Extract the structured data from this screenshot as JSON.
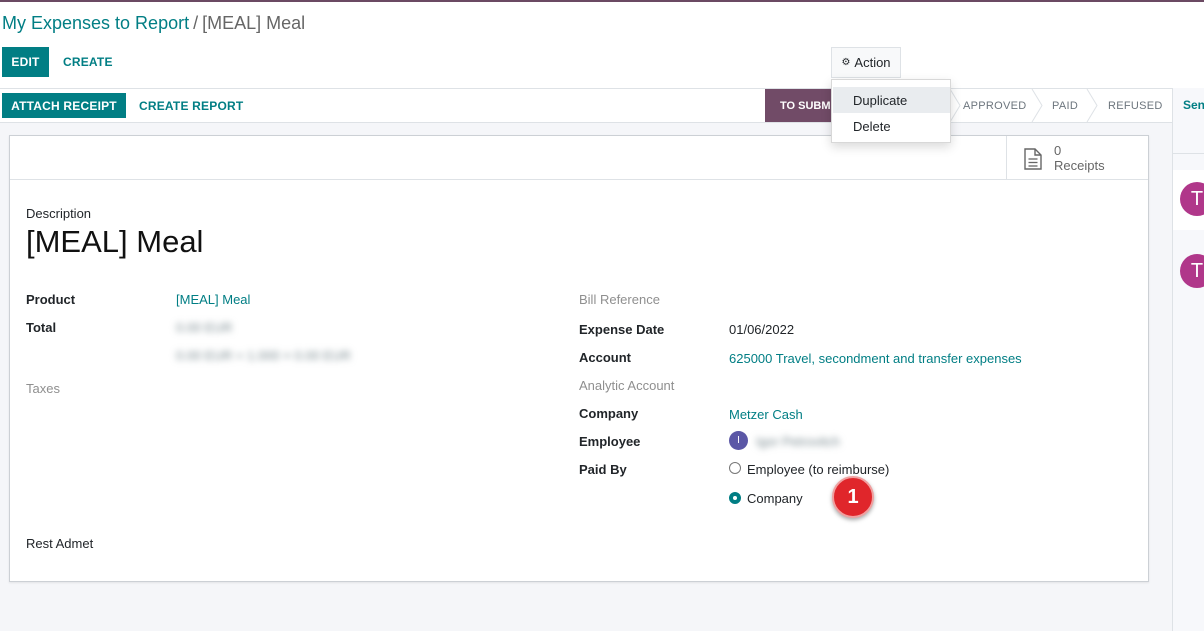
{
  "breadcrumb": {
    "parent": "My Expenses to Report",
    "separator": "/",
    "current": "[MEAL] Meal"
  },
  "control": {
    "edit_label": "EDIT",
    "create_label": "CREATE",
    "action_label": "Action"
  },
  "action_menu": {
    "items": [
      "Duplicate",
      "Delete"
    ]
  },
  "header": {
    "attach_label": "ATTACH RECEIPT",
    "create_report_label": "CREATE REPORT",
    "active_stage": "TO SUBMIT",
    "stages": [
      "APPROVED",
      "PAID",
      "REFUSED"
    ]
  },
  "chatter": {
    "send_label": "Send",
    "avatar_letter": "T"
  },
  "receipts": {
    "count": "0",
    "label": "Receipts"
  },
  "form": {
    "description_label": "Description",
    "title": "[MEAL] Meal",
    "product_label": "Product",
    "product_value": "[MEAL] Meal",
    "total_label": "Total",
    "total_value": "0.00 EUR",
    "total_detail": "0.00 EUR = 1.000 × 0.00 EUR",
    "taxes_label": "Taxes",
    "notes": "Rest Admet",
    "bill_ref_label": "Bill Reference",
    "expense_date_label": "Expense Date",
    "expense_date_value": "01/06/2022",
    "account_label": "Account",
    "account_value": "625000 Travel, secondment and transfer expenses",
    "analytic_label": "Analytic Account",
    "company_label": "Company",
    "company_value": "Metzer Cash",
    "employee_label": "Employee",
    "employee_initial": "I",
    "employee_value": "Igor Petrovitch",
    "paid_by_label": "Paid By",
    "paid_by_options": [
      "Employee (to reimburse)",
      "Company"
    ],
    "paid_by_selected": "Company"
  },
  "annotation": {
    "step_number": "1"
  },
  "colors": {
    "primary": "#017e84",
    "brand": "#714b67",
    "badge": "#e0262b"
  }
}
